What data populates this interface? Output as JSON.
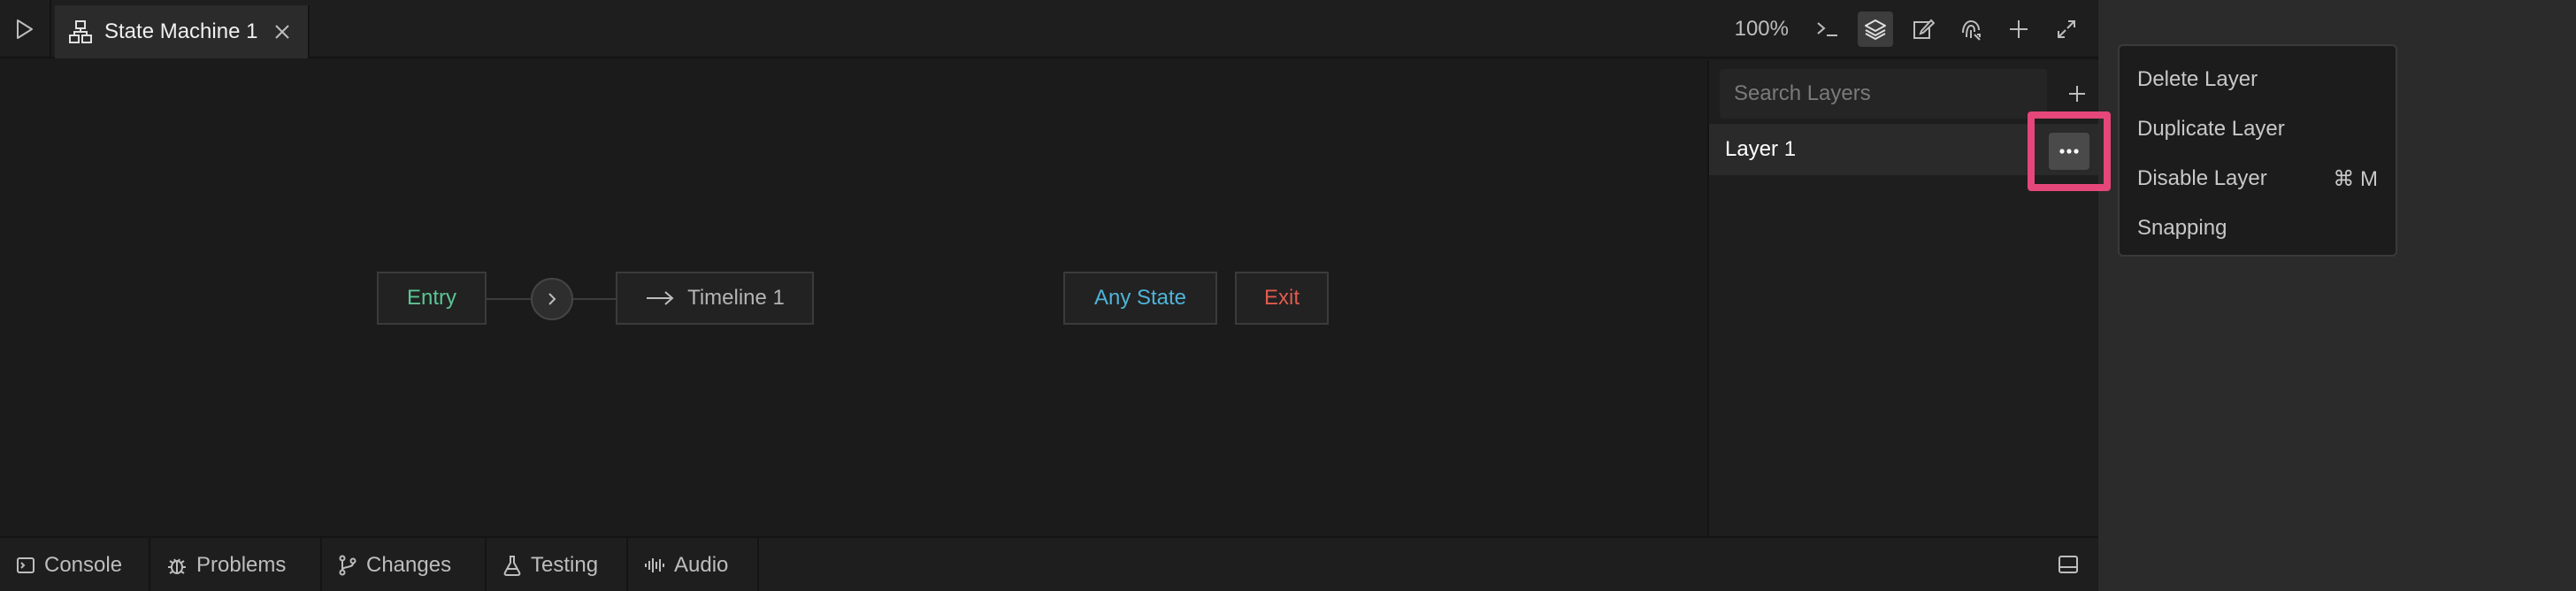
{
  "tab": {
    "title": "State Machine 1"
  },
  "toolbar": {
    "zoom": "100%"
  },
  "canvas": {
    "nodes": {
      "entry": "Entry",
      "timeline": "Timeline 1",
      "any_state": "Any State",
      "exit": "Exit"
    },
    "colors": {
      "entry": "#5cc495",
      "any_state": "#4fb3d9",
      "exit": "#e05a4f"
    }
  },
  "layers": {
    "search_placeholder": "Search Layers",
    "items": [
      {
        "label": "Layer 1"
      }
    ]
  },
  "bottom_tabs": {
    "console": "Console",
    "problems": "Problems",
    "changes": "Changes",
    "testing": "Testing",
    "audio": "Audio"
  },
  "context_menu": {
    "items": [
      {
        "label": "Delete Layer",
        "shortcut": ""
      },
      {
        "label": "Duplicate Layer",
        "shortcut": ""
      },
      {
        "label": "Disable Layer",
        "shortcut": "⌘ M"
      },
      {
        "label": "Snapping",
        "shortcut": ""
      }
    ]
  },
  "highlight_color": "#e5477a"
}
